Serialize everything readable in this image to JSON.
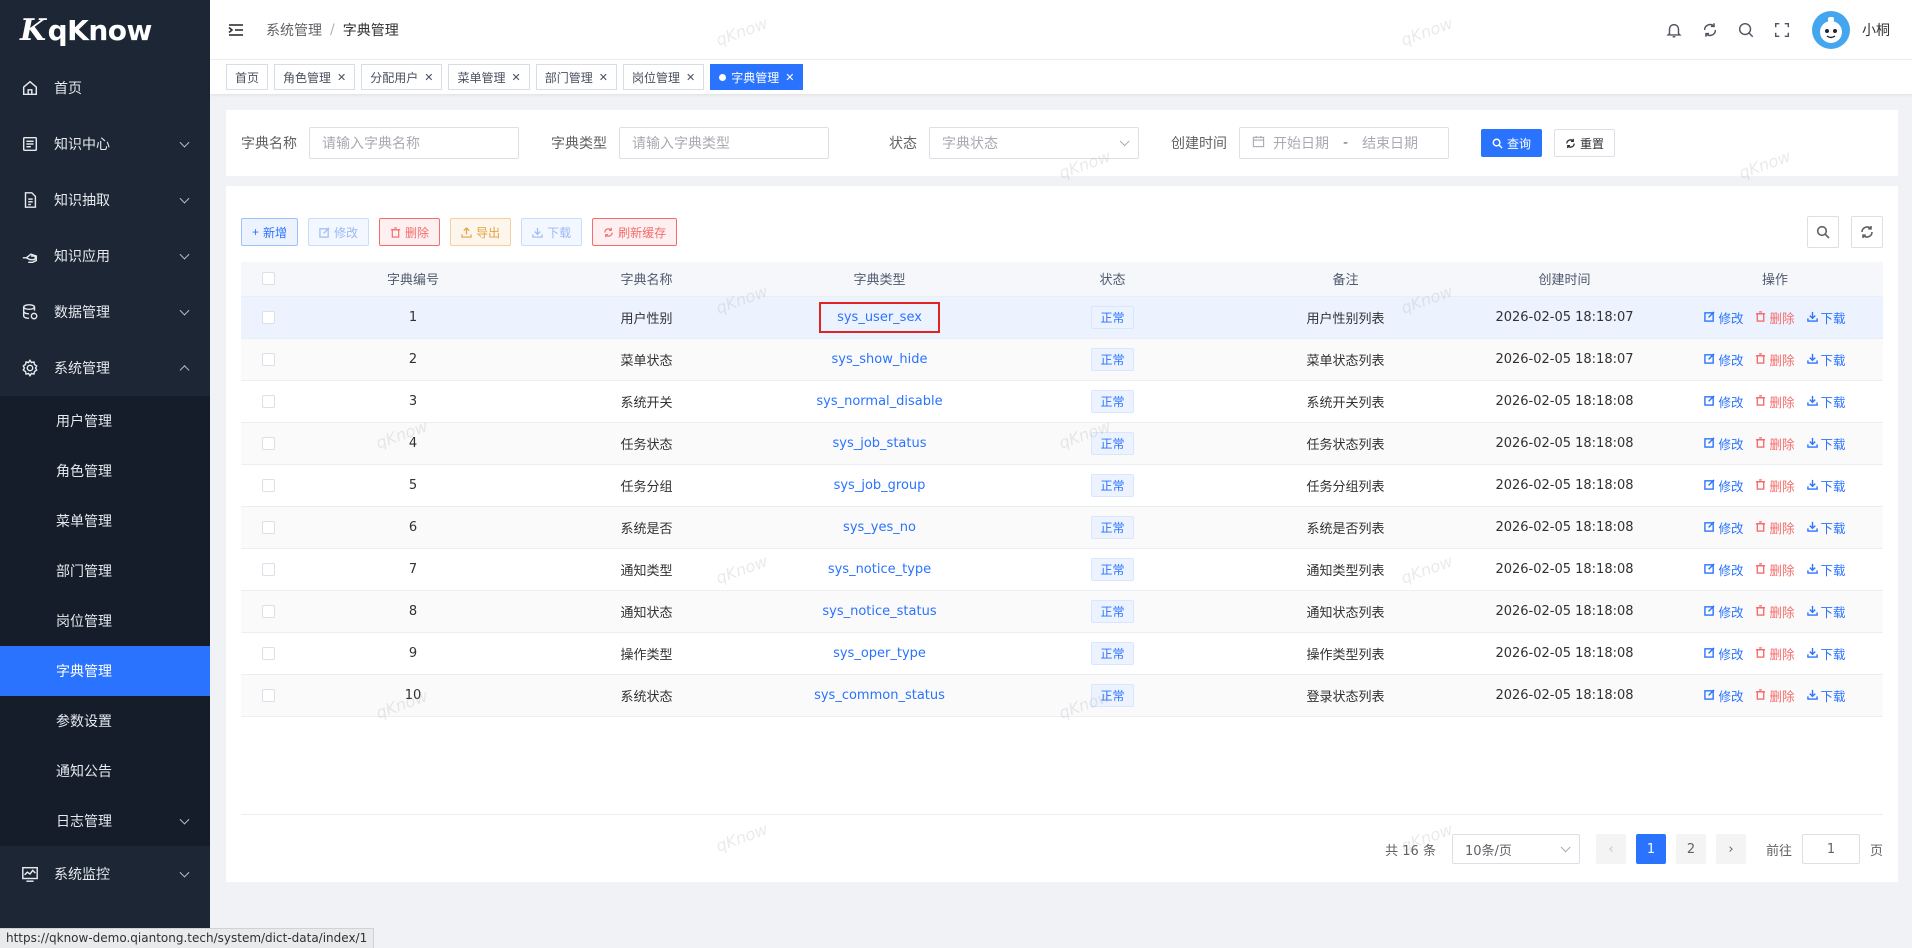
{
  "app": {
    "logo_text": "qKnow",
    "logo_mark": "K"
  },
  "sidebar": {
    "items": [
      {
        "label": "首页",
        "icon": "home-icon",
        "expandable": false
      },
      {
        "label": "知识中心",
        "icon": "book-icon",
        "expandable": true
      },
      {
        "label": "知识抽取",
        "icon": "document-icon",
        "expandable": true
      },
      {
        "label": "知识应用",
        "icon": "hand-icon",
        "expandable": true
      },
      {
        "label": "数据管理",
        "icon": "database-icon",
        "expandable": true
      },
      {
        "label": "系统管理",
        "icon": "gear-icon",
        "expandable": true,
        "expanded": true
      }
    ],
    "subitems": [
      {
        "label": "用户管理"
      },
      {
        "label": "角色管理"
      },
      {
        "label": "菜单管理"
      },
      {
        "label": "部门管理"
      },
      {
        "label": "岗位管理"
      },
      {
        "label": "字典管理",
        "active": true
      },
      {
        "label": "参数设置"
      },
      {
        "label": "通知公告"
      },
      {
        "label": "日志管理",
        "expandable": true
      }
    ],
    "bottom_item": {
      "label": "系统监控",
      "icon": "monitor-icon"
    }
  },
  "header": {
    "breadcrumb": [
      "系统管理",
      "字典管理"
    ],
    "breadcrumb_sep": "/",
    "username": "小桐",
    "icons": [
      "bell-icon",
      "refresh-icon",
      "search-icon",
      "fullscreen-icon"
    ]
  },
  "tags": [
    {
      "label": "首页",
      "closable": false
    },
    {
      "label": "角色管理",
      "closable": true
    },
    {
      "label": "分配用户",
      "closable": true
    },
    {
      "label": "菜单管理",
      "closable": true
    },
    {
      "label": "部门管理",
      "closable": true
    },
    {
      "label": "岗位管理",
      "closable": true
    },
    {
      "label": "字典管理",
      "closable": true,
      "active": true
    }
  ],
  "search": {
    "name_label": "字典名称",
    "name_placeholder": "请输入字典名称",
    "type_label": "字典类型",
    "type_placeholder": "请输入字典类型",
    "status_label": "状态",
    "status_placeholder": "字典状态",
    "time_label": "创建时间",
    "start_placeholder": "开始日期",
    "range_sep": "-",
    "end_placeholder": "结束日期",
    "query_label": "查询",
    "reset_label": "重置"
  },
  "toolbar": {
    "add": "新增",
    "edit": "修改",
    "delete": "删除",
    "export": "导出",
    "download": "下载",
    "refresh_cache": "刷新缓存"
  },
  "table": {
    "headers": [
      "字典编号",
      "字典名称",
      "字典类型",
      "状态",
      "备注",
      "创建时间",
      "操作"
    ],
    "op_labels": {
      "edit": "修改",
      "delete": "删除",
      "download": "下载"
    },
    "rows": [
      {
        "id": "1",
        "name": "用户性别",
        "type": "sys_user_sex",
        "status": "正常",
        "remark": "用户性别列表",
        "created": "2026-02-05 18:18:07"
      },
      {
        "id": "2",
        "name": "菜单状态",
        "type": "sys_show_hide",
        "status": "正常",
        "remark": "菜单状态列表",
        "created": "2026-02-05 18:18:07"
      },
      {
        "id": "3",
        "name": "系统开关",
        "type": "sys_normal_disable",
        "status": "正常",
        "remark": "系统开关列表",
        "created": "2026-02-05 18:18:08"
      },
      {
        "id": "4",
        "name": "任务状态",
        "type": "sys_job_status",
        "status": "正常",
        "remark": "任务状态列表",
        "created": "2026-02-05 18:18:08"
      },
      {
        "id": "5",
        "name": "任务分组",
        "type": "sys_job_group",
        "status": "正常",
        "remark": "任务分组列表",
        "created": "2026-02-05 18:18:08"
      },
      {
        "id": "6",
        "name": "系统是否",
        "type": "sys_yes_no",
        "status": "正常",
        "remark": "系统是否列表",
        "created": "2026-02-05 18:18:08"
      },
      {
        "id": "7",
        "name": "通知类型",
        "type": "sys_notice_type",
        "status": "正常",
        "remark": "通知类型列表",
        "created": "2026-02-05 18:18:08"
      },
      {
        "id": "8",
        "name": "通知状态",
        "type": "sys_notice_status",
        "status": "正常",
        "remark": "通知状态列表",
        "created": "2026-02-05 18:18:08"
      },
      {
        "id": "9",
        "name": "操作类型",
        "type": "sys_oper_type",
        "status": "正常",
        "remark": "操作类型列表",
        "created": "2026-02-05 18:18:08"
      },
      {
        "id": "10",
        "name": "系统状态",
        "type": "sys_common_status",
        "status": "正常",
        "remark": "登录状态列表",
        "created": "2026-02-05 18:18:08"
      }
    ]
  },
  "pagination": {
    "total_text": "共 16 条",
    "page_size": "10条/页",
    "pages": [
      "1",
      "2"
    ],
    "current_page": "1",
    "goto_label": "前往",
    "goto_value": "1",
    "page_suffix": "页"
  },
  "watermark_text": "qKnow",
  "status_url": "https://qknow-demo.qiantong.tech/system/dict-data/index/1",
  "colors": {
    "primary": "#2a73ff",
    "sidebar_bg": "#1c2634",
    "danger": "#f56c6c",
    "warning": "#e6a23c",
    "highlight_box": "#e02424"
  }
}
